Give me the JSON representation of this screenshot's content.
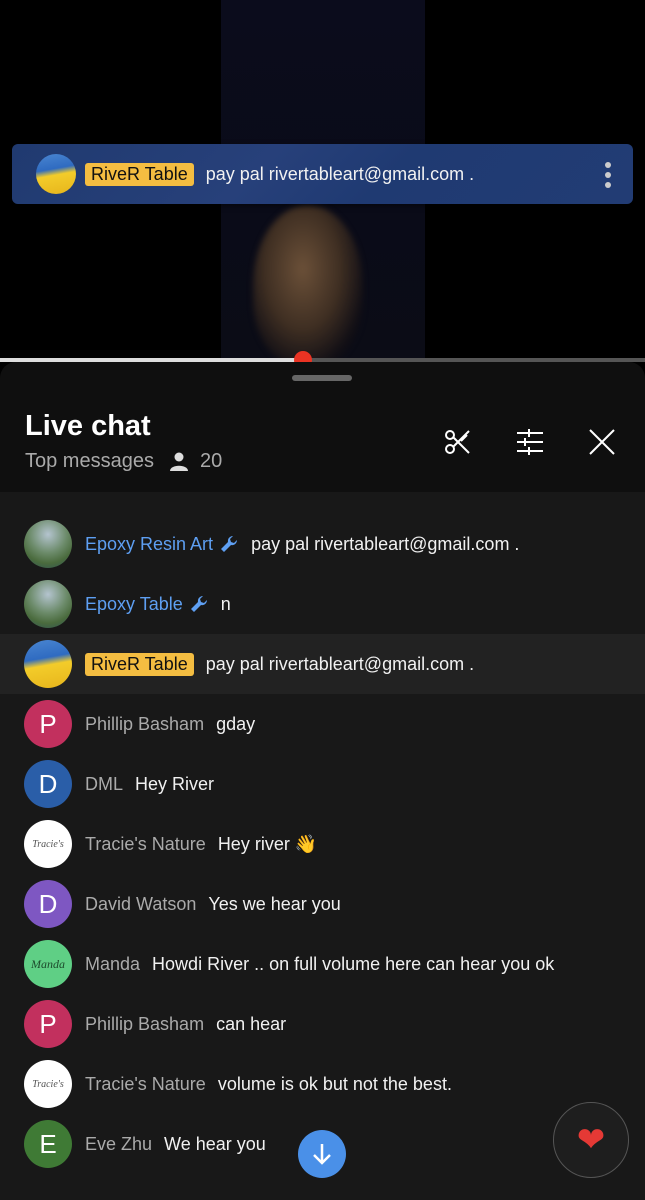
{
  "video": {
    "progress_percent": 47,
    "accent_color": "#ea3323"
  },
  "header": {
    "title": "Live chat",
    "mode": "Top messages",
    "viewer_count": "20",
    "icons": [
      "clip-icon",
      "filter-sliders-icon",
      "close-icon"
    ]
  },
  "pinned": {
    "author": "RiveR Table",
    "author_role": "owner",
    "text": "pay pal rivertableart@gmail.com .",
    "avatar": "ukraine-flag"
  },
  "messages": [
    {
      "author": "Epoxy Resin Art",
      "role": "moderator",
      "text": "pay pal rivertableart@gmail.com .",
      "avatar": "photo"
    },
    {
      "author": "Epoxy Table",
      "role": "moderator",
      "text": "n",
      "avatar": "photo"
    },
    {
      "author": "RiveR Table",
      "role": "owner",
      "text": "pay pal rivertableart@gmail.com .",
      "avatar": "ukraine-flag"
    },
    {
      "author": "Phillip Basham",
      "role": "viewer",
      "text": "gday",
      "avatar_letter": "P",
      "avatar_color": "#c2305e"
    },
    {
      "author": "DML",
      "role": "viewer",
      "text": "Hey River",
      "avatar_letter": "D",
      "avatar_color": "#2a5ea8"
    },
    {
      "author": "Tracie's Nature",
      "role": "viewer",
      "text": "Hey river 👋",
      "avatar": "tracies-logo"
    },
    {
      "author": "David Watson",
      "role": "viewer",
      "text": "Yes we hear you",
      "avatar_letter": "D",
      "avatar_color": "#7e57c2"
    },
    {
      "author": "Manda",
      "role": "viewer",
      "text": "Howdi River .. on full volume here can hear you ok",
      "avatar": "manda-logo"
    },
    {
      "author": "Phillip Basham",
      "role": "viewer",
      "text": "can hear",
      "avatar_letter": "P",
      "avatar_color": "#c2305e"
    },
    {
      "author": "Tracie's Nature",
      "role": "viewer",
      "text": "volume is ok but not the best.",
      "avatar": "tracies-logo"
    },
    {
      "author": "Eve Zhu",
      "role": "viewer",
      "text": "We hear you",
      "avatar_letter": "E",
      "avatar_color": "#3f7a35"
    }
  ],
  "logos": {
    "manda": "Manda",
    "tracies": "Tracie's"
  },
  "buttons": {
    "scroll_down": "arrow-down-icon",
    "reaction": "❤"
  }
}
